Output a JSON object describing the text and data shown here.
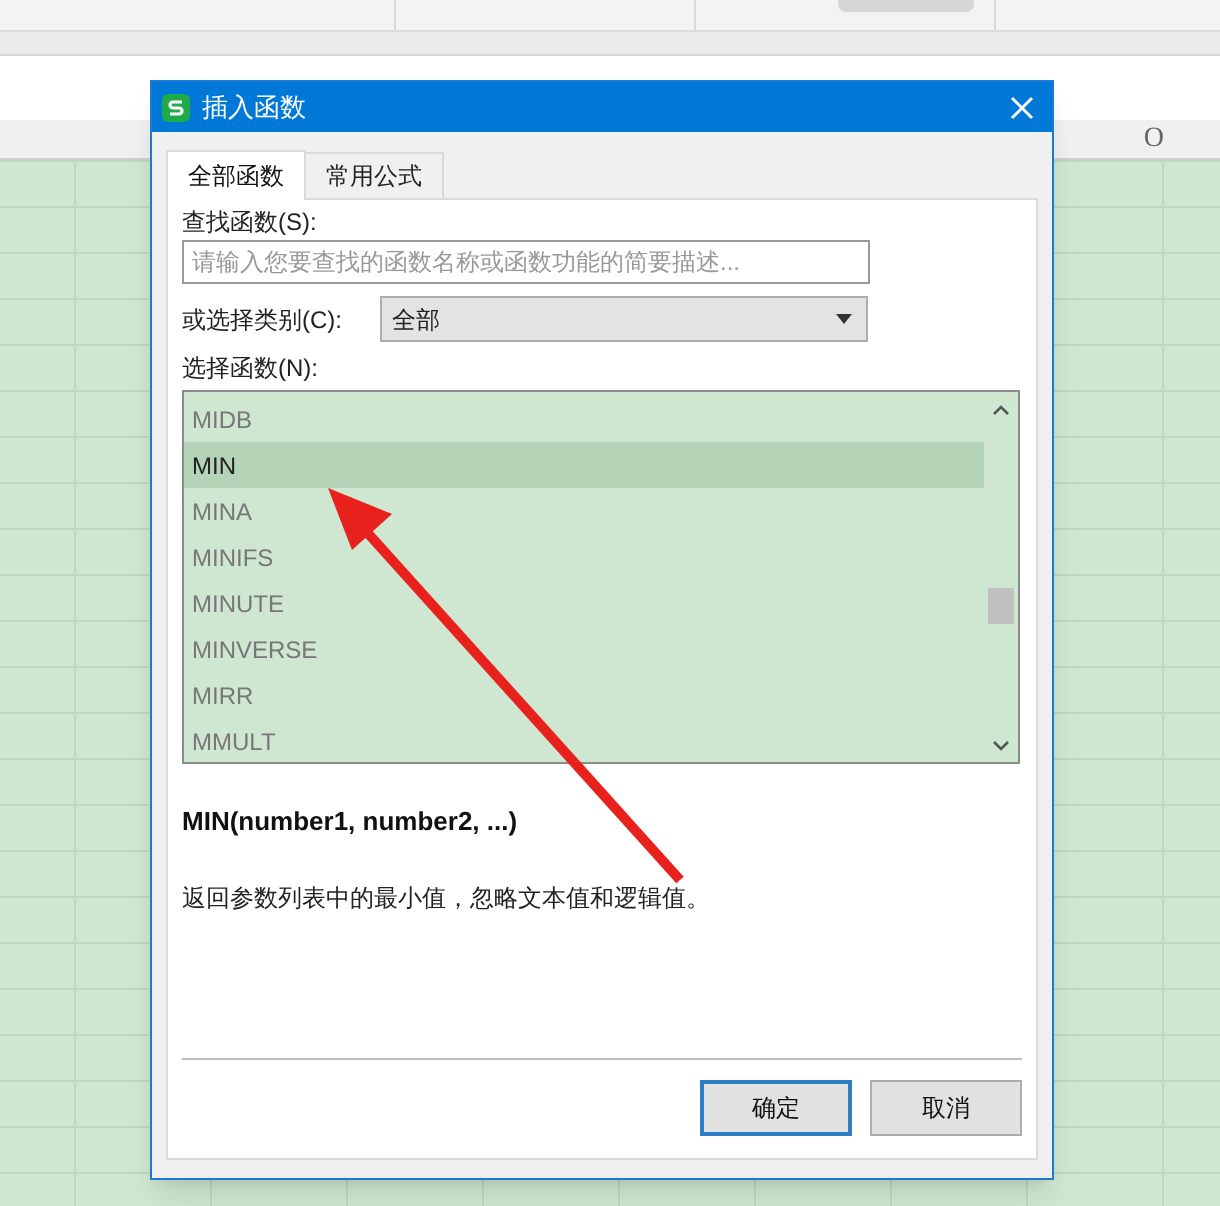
{
  "spreadsheet": {
    "column_headers": [
      "O"
    ]
  },
  "window": {
    "title": "插入函数"
  },
  "tabs": [
    {
      "label": "全部函数",
      "selected": true
    },
    {
      "label": "常用公式",
      "selected": false
    }
  ],
  "search": {
    "label": "查找函数(S):",
    "placeholder": "请输入您要查找的函数名称或函数功能的简要描述..."
  },
  "category": {
    "label": "或选择类别(C):",
    "value": "全部"
  },
  "function_list": {
    "label": "选择函数(N):",
    "items": [
      {
        "name": "MIDB",
        "selected": false
      },
      {
        "name": "MIN",
        "selected": true
      },
      {
        "name": "MINA",
        "selected": false
      },
      {
        "name": "MINIFS",
        "selected": false
      },
      {
        "name": "MINUTE",
        "selected": false
      },
      {
        "name": "MINVERSE",
        "selected": false
      },
      {
        "name": "MIRR",
        "selected": false
      },
      {
        "name": "MMULT",
        "selected": false
      }
    ]
  },
  "signature": "MIN(number1, number2, ...)",
  "description": "返回参数列表中的最小值，忽略文本值和逻辑值。",
  "buttons": [
    {
      "label": "确定",
      "focused": true
    },
    {
      "label": "取消",
      "focused": false
    }
  ]
}
